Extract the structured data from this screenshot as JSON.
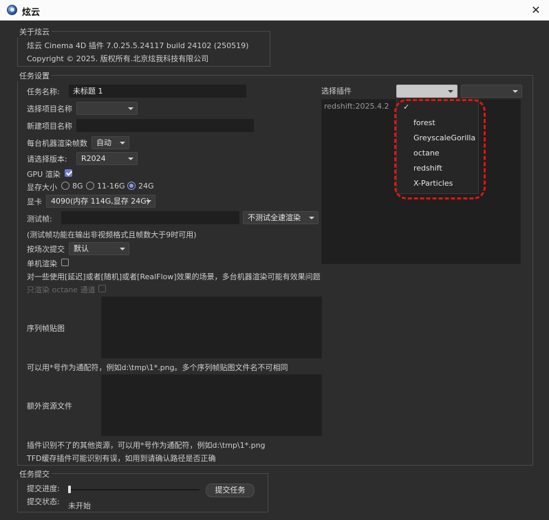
{
  "window": {
    "title": "炫云",
    "close_glyph": "✕"
  },
  "about": {
    "group_title": "关于炫云",
    "version_line": "炫云 Cinema 4D 插件 7.0.25.5.24117 build 24102  (250519)",
    "copyright_line": "Copyright © 2025. 版权所有.北京炫我科技有限公司"
  },
  "task_settings": {
    "group_title": "任务设置",
    "task_name_label": "任务名称:",
    "task_name_value": "未标题 1",
    "select_project_label": "选择项目名称",
    "select_project_value": "",
    "new_project_label": "新建项目名称",
    "new_project_value": "",
    "frames_per_machine_label": "每台机器渲染帧数",
    "frames_per_machine_value": "自动",
    "version_label": "请选择版本:",
    "version_value": "R2024",
    "gpu_render_label": "GPU 渲染",
    "gpu_render_checked": true,
    "vram_label": "显存大小",
    "vram_options": [
      "8G",
      "11-16G",
      "24G"
    ],
    "vram_selected": "24G",
    "gpu_card_label": "显卡",
    "gpu_card_value": "4090(内存 114G,显存 24G)",
    "test_frames_label": "测试帧:",
    "test_frames_value": "",
    "test_mode_value": "不测试全速渲染",
    "test_note": "(测试帧功能在输出非视频格式且帧数大于9时可用)",
    "submit_by_take_label": "按场次提交",
    "submit_by_take_value": "默认",
    "single_machine_label": "单机渲染",
    "single_machine_checked": false,
    "single_machine_note": "对一些使用[延迟]或者[随机]或者[RealFlow]效果的场景，多台机器渲染可能有效果问题",
    "octane_only_label": "只渲染 octane 通道",
    "octane_only_checked": false,
    "sequence_label": "序列帧贴图",
    "sequence_value": "",
    "sequence_note": "可以用*号作为通配符，例如d:\\tmp\\1*.png。多个序列帧贴图文件名不可相同",
    "extra_assets_label": "额外资源文件",
    "extra_assets_value": "",
    "extra_assets_note": "插件识别不了的其他资源，可以用*号作为通配符，例如d:\\tmp\\1*.png",
    "tfd_note": "TFD缓存插件可能识别有误，如用到请确认路径是否正确"
  },
  "plugins": {
    "label": "选择插件",
    "combo1_value": "",
    "combo2_value": "",
    "list_items": [
      "redshift:2025.4.2"
    ],
    "menu_checkmark": "✓",
    "menu_items": [
      "forest",
      "GreyscaleGorilla",
      "octane",
      "redshift",
      "X-Particles"
    ]
  },
  "submit": {
    "group_title": "任务提交",
    "progress_label": "提交进度:",
    "progress_value": 0,
    "status_label": "提交状态:",
    "status_value": "未开始",
    "submit_button": "提交任务"
  },
  "colors": {
    "background": "#2d2d2d",
    "field": "#1f1f1f",
    "accent": "#6f7cd6",
    "highlight": "#e01515"
  }
}
